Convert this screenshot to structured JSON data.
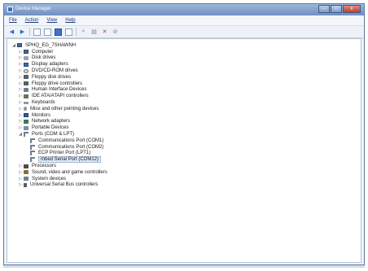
{
  "window": {
    "title": "Device Manager",
    "controls": {
      "minimize": "–",
      "maximize": "□",
      "close": "x"
    }
  },
  "menu": [
    "File",
    "Action",
    "View",
    "Help"
  ],
  "toolbar_icons": [
    "back-arrow-icon",
    "forward-arrow-icon",
    "console-tree-icon",
    "properties-icon",
    "help-icon",
    "view-icon",
    "scan-hardware-icon",
    "update-driver-icon",
    "disable-device-icon",
    "uninstall-device-icon"
  ],
  "tree": {
    "root": "SPHQ_EG_7SHAWNH",
    "categories": [
      {
        "label": "Computer",
        "expanded": false,
        "icon": "computer-icon"
      },
      {
        "label": "Disk drives",
        "expanded": false,
        "icon": "disk-icon"
      },
      {
        "label": "Display adapters",
        "expanded": false,
        "icon": "display-icon"
      },
      {
        "label": "DVD/CD-ROM drives",
        "expanded": false,
        "icon": "dvd-icon"
      },
      {
        "label": "Floppy disk drives",
        "expanded": false,
        "icon": "floppy-icon"
      },
      {
        "label": "Floppy drive controllers",
        "expanded": false,
        "icon": "floppy-icon"
      },
      {
        "label": "Human Interface Devices",
        "expanded": false,
        "icon": "hid-icon"
      },
      {
        "label": "IDE ATA/ATAPI controllers",
        "expanded": false,
        "icon": "ide-icon"
      },
      {
        "label": "Keyboards",
        "expanded": false,
        "icon": "keyboard-icon"
      },
      {
        "label": "Mice and other pointing devices",
        "expanded": false,
        "icon": "mouse-icon"
      },
      {
        "label": "Monitors",
        "expanded": false,
        "icon": "monitor-icon"
      },
      {
        "label": "Network adapters",
        "expanded": false,
        "icon": "network-icon"
      },
      {
        "label": "Portable Devices",
        "expanded": false,
        "icon": "portable-icon"
      },
      {
        "label": "Ports (COM & LPT)",
        "expanded": true,
        "icon": "port-icon"
      },
      {
        "label": "Processors",
        "expanded": false,
        "icon": "processor-icon"
      },
      {
        "label": "Sound, video and game controllers",
        "expanded": false,
        "icon": "sound-icon"
      },
      {
        "label": "System devices",
        "expanded": false,
        "icon": "system-icon"
      },
      {
        "label": "Universal Serial Bus controllers",
        "expanded": false,
        "icon": "usb-icon"
      }
    ],
    "ports_children": [
      {
        "label": "Communications Port (COM1)",
        "selected": false
      },
      {
        "label": "Communications Port (COM2)",
        "selected": false
      },
      {
        "label": "ECP Printer Port (LPT1)",
        "selected": false
      },
      {
        "label": "mbed Serial Port (COM12)",
        "selected": true
      }
    ]
  },
  "colors": {
    "titlebar": "#7f9cc9",
    "selection": "#dce8f7",
    "menu_text": "#1e3c7a"
  }
}
